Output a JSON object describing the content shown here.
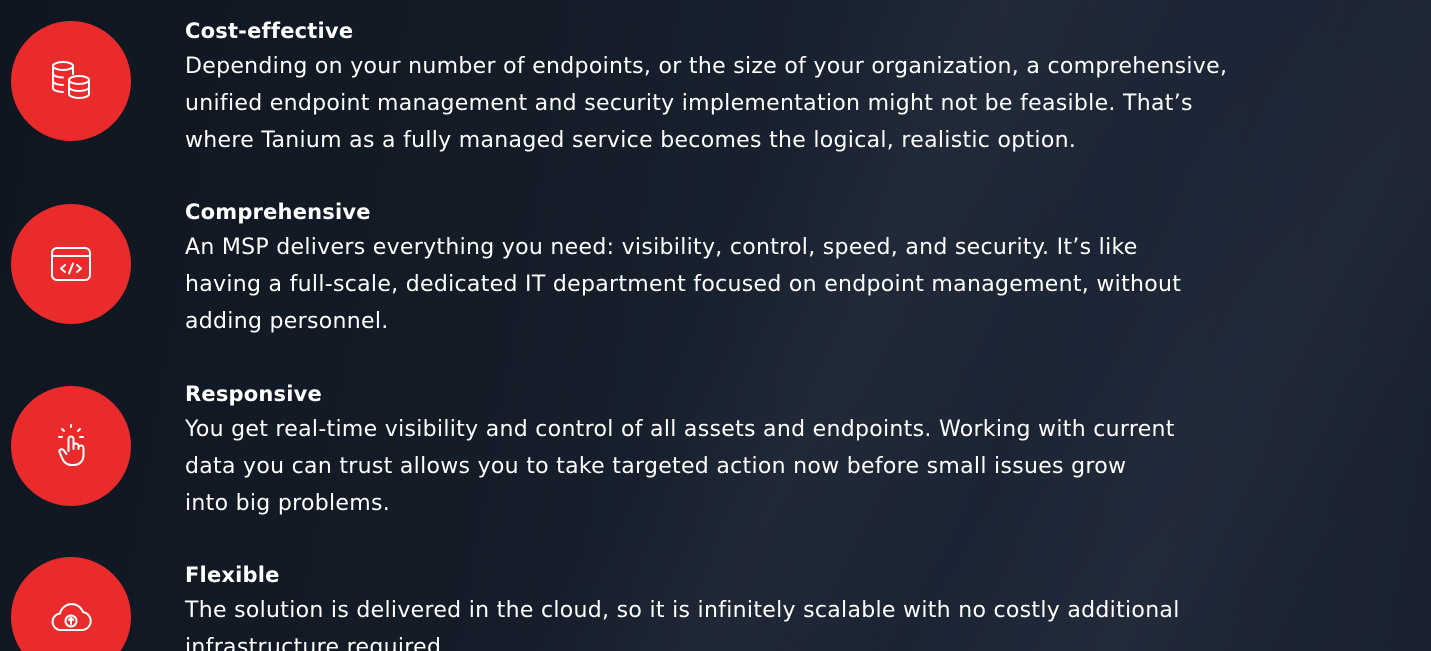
{
  "features": [
    {
      "title": "Cost-effective",
      "description": "Depending on your number of endpoints, or the size of your organization, a comprehensive,\nunified endpoint management and security implementation might not be feasible. That’s\nwhere Tanium as a fully managed service becomes the logical, realistic option.",
      "icon": "database-stack-icon"
    },
    {
      "title": "Comprehensive",
      "description": "An MSP delivers everything you need: visibility, control, speed, and security. It’s like\nhaving a full-scale, dedicated IT department focused on endpoint management, without\nadding personnel.",
      "icon": "code-window-icon"
    },
    {
      "title": "Responsive",
      "description": "You get real-time visibility and control of all assets and endpoints. Working with current\ndata you can trust allows you to take targeted action now before small issues grow\ninto big problems.",
      "icon": "tap-hand-icon"
    },
    {
      "title": "Flexible",
      "description": "The solution is delivered in the cloud, so it is infinitely scalable with no costly additional\ninfrastructure required.",
      "icon": "cloud-upload-icon"
    }
  ],
  "colors": {
    "accent": "#ea2b2b",
    "background": "#141c28",
    "text": "#ffffff"
  }
}
